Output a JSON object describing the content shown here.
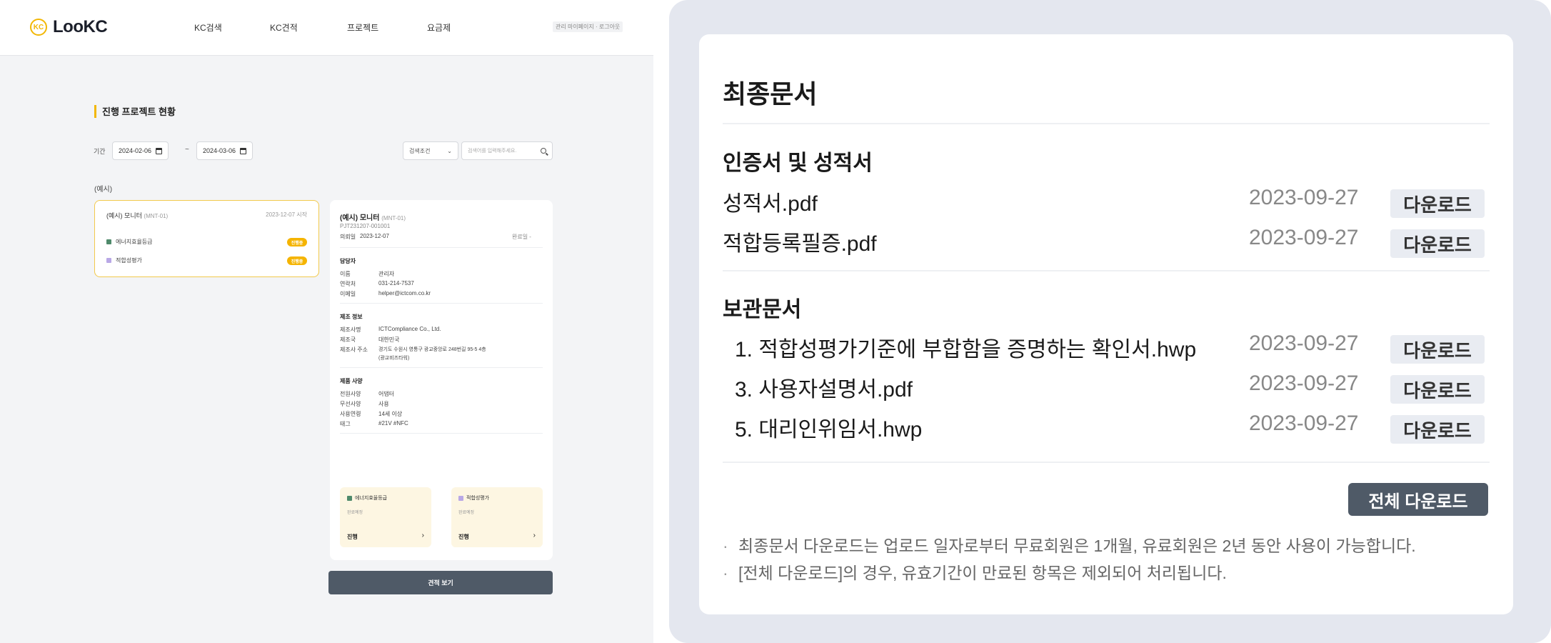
{
  "left": {
    "logo": {
      "mark": "KC",
      "text": "LooKC"
    },
    "nav": [
      "KC검색",
      "KC견적",
      "프로젝트",
      "요금제"
    ],
    "user_menu": "관리 마이페이지 · 로그아웃",
    "section_title": "진행 프로젝트 현황",
    "period": {
      "label": "기간",
      "from": "2024-02-06",
      "tilde": "~",
      "to": "2024-03-06"
    },
    "search": {
      "condition": "검색조건",
      "placeholder": "검색어를 입력해주세요."
    },
    "example_label": "(예시)",
    "project_card": {
      "name": "(예시) 모니터",
      "code": "(MNT-01)",
      "date": "2023-12-07 시작",
      "items": [
        {
          "label": "에너지효율등급",
          "tag": "진행중",
          "color": "#4f8a6b"
        },
        {
          "label": "적합성평가",
          "tag": "진행중",
          "color": "#b9a8e6"
        }
      ]
    },
    "detail": {
      "name": "(예시) 모니터",
      "code": "(MNT-01)",
      "pjt": "PJT231207-001001",
      "date_label": "의뢰일",
      "date_value": "2023-12-07",
      "status": "완료일 -",
      "manager": {
        "title": "담당자",
        "rows": [
          [
            "이름",
            "관리자"
          ],
          [
            "연락처",
            "031-214-7537"
          ],
          [
            "이메일",
            "helper@ictcom.co.kr"
          ]
        ]
      },
      "maker": {
        "title": "제조 정보",
        "rows": [
          [
            "제조사명",
            "ICTCompliance Co., Ltd."
          ],
          [
            "제조국",
            "대한민국"
          ],
          [
            "제조사 주소",
            "경기도 수원시 영통구 광교중앙로 248번길 95-5 4층"
          ],
          [
            "",
            "(광교비즈타워)"
          ]
        ]
      },
      "product": {
        "title": "제품 사양",
        "rows": [
          [
            "전원사양",
            "어댑터"
          ],
          [
            "무선사양",
            "사용"
          ],
          [
            "사용연령",
            "14세 이상"
          ],
          [
            "태그",
            "#21V  #NFC"
          ]
        ]
      },
      "cards": [
        {
          "title": "에너지효율등급",
          "sub": "완료예정",
          "status": "진행",
          "color": "#4f8a6b"
        },
        {
          "title": "적합성평가",
          "sub": "완료예정",
          "status": "진행",
          "color": "#b9a8e6"
        }
      ]
    },
    "quote_button": "견적 보기"
  },
  "right": {
    "title": "최종문서",
    "sections": [
      {
        "title": "인증서 및 성적서",
        "files": [
          {
            "name": "성적서.pdf",
            "date": "2023-09-27",
            "action": "다운로드"
          },
          {
            "name": "적합등록필증.pdf",
            "date": "2023-09-27",
            "action": "다운로드"
          }
        ]
      },
      {
        "title": "보관문서",
        "files": [
          {
            "name": "1. 적합성평가기준에 부합함을 증명하는 확인서.hwp",
            "date": "2023-09-27",
            "action": "다운로드"
          },
          {
            "name": "3. 사용자설명서.pdf",
            "date": "2023-09-27",
            "action": "다운로드"
          },
          {
            "name": "5. 대리인위임서.hwp",
            "date": "2023-09-27",
            "action": "다운로드"
          }
        ]
      }
    ],
    "download_all": "전체 다운로드",
    "notes": [
      "최종문서 다운로드는 업로드 일자로부터 무료회원은 1개월, 유료회원은 2년 동안 사용이 가능합니다.",
      "[전체 다운로드]의 경우, 유효기간이 만료된 항목은 제외되어 처리됩니다."
    ],
    "bullet": "·"
  }
}
